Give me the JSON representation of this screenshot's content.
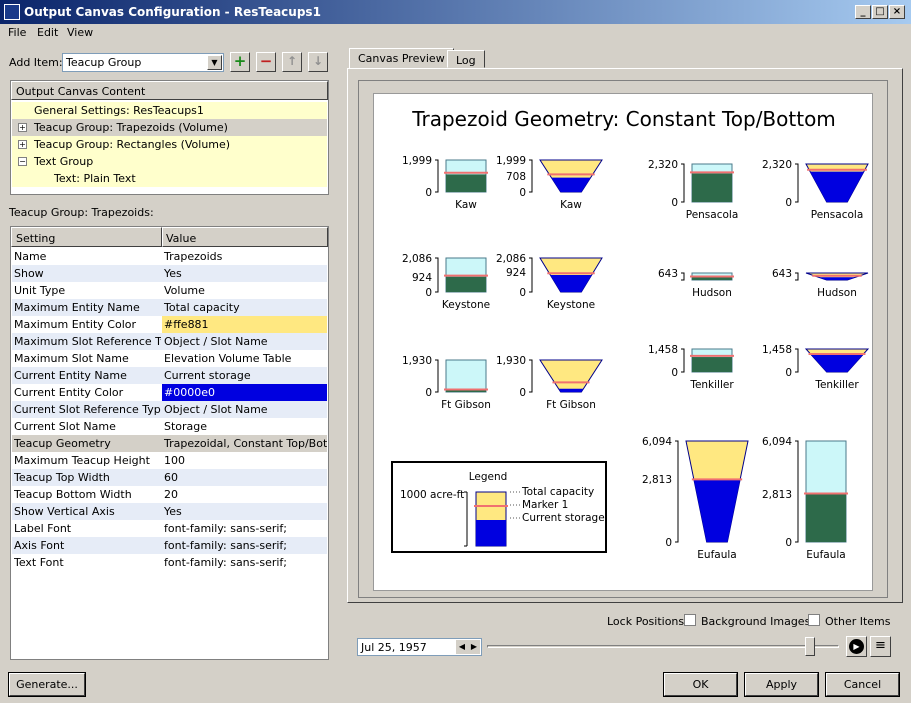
{
  "window": {
    "title": "Output Canvas Configuration - ResTeacups1"
  },
  "menu": [
    "File",
    "Edit",
    "View"
  ],
  "toolbar": {
    "add_item_label": "Add Item:",
    "add_item_value": "Teacup Group"
  },
  "content_tree": {
    "header": "Output Canvas Content",
    "items": [
      "General Settings: ResTeacups1",
      "Teacup Group: Trapezoids (Volume)",
      "Teacup Group: Rectangles (Volume)",
      "Text Group",
      "Text: Plain Text"
    ]
  },
  "properties": {
    "section_label": "Teacup Group: Trapezoids:",
    "col_setting": "Setting",
    "col_value": "Value",
    "rows": [
      {
        "setting": "Name",
        "value": "Trapezoids"
      },
      {
        "setting": "Show",
        "value": "Yes"
      },
      {
        "setting": "Unit Type",
        "value": "Volume"
      },
      {
        "setting": "Maximum Entity Name",
        "value": "Total capacity"
      },
      {
        "setting": "Maximum Entity Color",
        "value": "#ffe881"
      },
      {
        "setting": "Maximum Slot Reference Type",
        "value": "Object / Slot Name"
      },
      {
        "setting": "Maximum Slot Name",
        "value": "Elevation Volume Table"
      },
      {
        "setting": "Current Entity Name",
        "value": "Current storage"
      },
      {
        "setting": "Current Entity Color",
        "value": "#0000e0"
      },
      {
        "setting": "Current Slot Reference Type",
        "value": "Object / Slot Name"
      },
      {
        "setting": "Current Slot Name",
        "value": "Storage"
      },
      {
        "setting": "Teacup Geometry",
        "value": "Trapezoidal, Constant Top/Bot"
      },
      {
        "setting": "Maximum Teacup Height",
        "value": "100"
      },
      {
        "setting": "Teacup Top Width",
        "value": "60"
      },
      {
        "setting": "Teacup Bottom Width",
        "value": "20"
      },
      {
        "setting": "Show Vertical Axis",
        "value": "Yes"
      },
      {
        "setting": "Label Font",
        "value": "font-family: sans-serif;"
      },
      {
        "setting": "Axis Font",
        "value": "font-family: sans-serif;"
      },
      {
        "setting": "Text Font",
        "value": "font-family: sans-serif;"
      }
    ]
  },
  "tabs": [
    "Canvas Preview",
    "Log"
  ],
  "canvas": {
    "title": "Trapezoid Geometry: Constant Top/Bottom",
    "colors": {
      "capacity": "#ffe881",
      "storage": "#0000e0",
      "rect_capacity": "#ccf7f9",
      "rect_storage": "#2d6a4a",
      "marker": "#f07070"
    },
    "teacups": [
      {
        "name": "Kaw",
        "shape": "rect",
        "max": "1,999",
        "zero": "0",
        "cur": ""
      },
      {
        "name": "Kaw",
        "shape": "trap",
        "max": "1,999",
        "mid": "708",
        "zero": "0"
      },
      {
        "name": "Pensacola",
        "shape": "rect",
        "max": "2,320",
        "zero": "0"
      },
      {
        "name": "Pensacola",
        "shape": "trap",
        "max": "2,320",
        "zero": "0"
      },
      {
        "name": "Keystone",
        "shape": "rect",
        "max": "2,086",
        "mid": "924",
        "zero": "0"
      },
      {
        "name": "Keystone",
        "shape": "trap",
        "max": "2,086",
        "mid": "924",
        "zero": "0"
      },
      {
        "name": "Hudson",
        "shape": "rect",
        "max": "643"
      },
      {
        "name": "Hudson",
        "shape": "trap",
        "max": "643"
      },
      {
        "name": "Ft Gibson",
        "shape": "rect",
        "max": "1,930",
        "zero": "0"
      },
      {
        "name": "Ft Gibson",
        "shape": "trap",
        "max": "1,930",
        "zero": "0"
      },
      {
        "name": "Tenkiller",
        "shape": "rect",
        "max": "1,458",
        "zero": "0"
      },
      {
        "name": "Tenkiller",
        "shape": "trap",
        "max": "1,458",
        "zero": "0"
      },
      {
        "name": "Eufaula",
        "shape": "trap",
        "max": "6,094",
        "mid": "2,813",
        "zero": "0"
      },
      {
        "name": "Eufaula",
        "shape": "rect",
        "max": "6,094",
        "mid": "2,813",
        "zero": "0"
      }
    ],
    "legend": {
      "title": "Legend",
      "scale": "1000 acre-ft",
      "items": [
        "Total capacity",
        "Marker 1",
        "Current storage"
      ]
    }
  },
  "lock_positions": {
    "label": "Lock Positions:",
    "background_images": "Background Images",
    "other_items": "Other Items"
  },
  "date": "Jul 25, 1957",
  "buttons": {
    "generate": "Generate...",
    "ok": "OK",
    "apply": "Apply",
    "cancel": "Cancel"
  }
}
